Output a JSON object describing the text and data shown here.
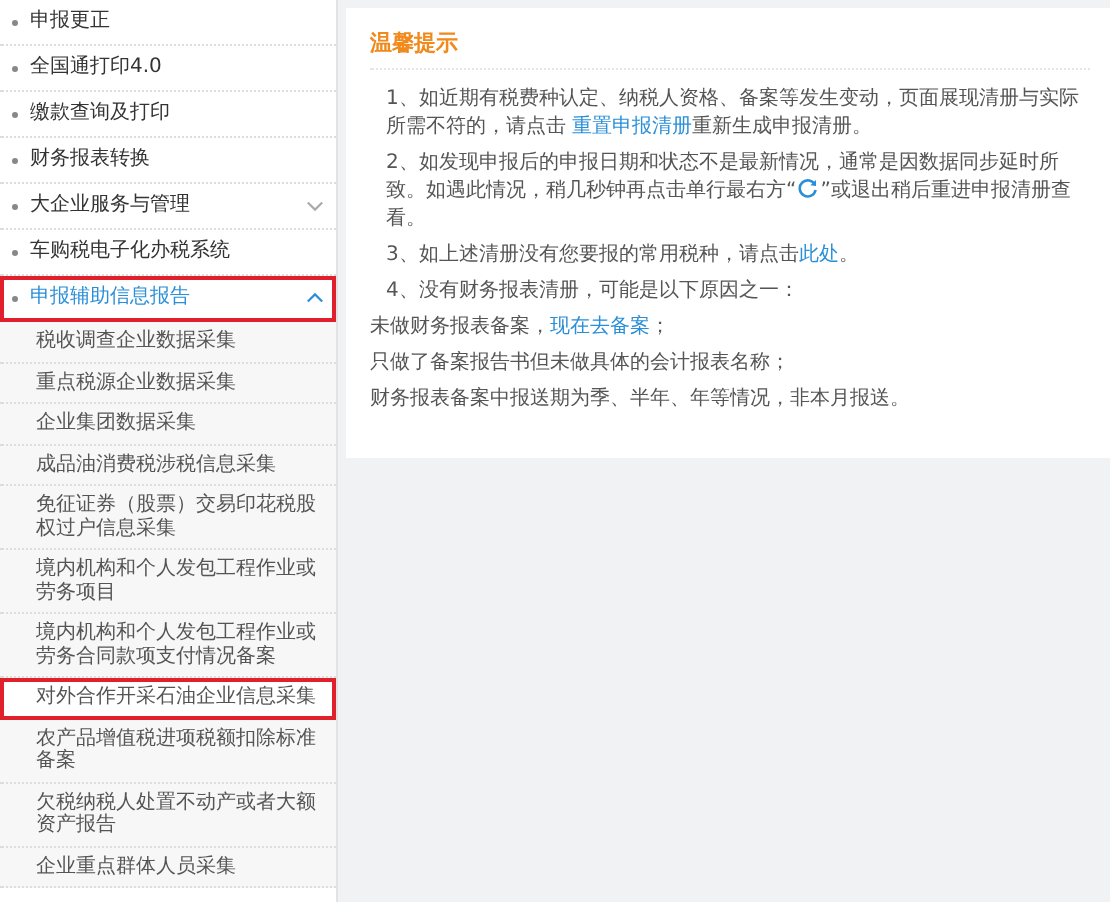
{
  "sidebar": {
    "items": [
      {
        "label": "申报更正",
        "selected": false,
        "marked": false
      },
      {
        "label": "全国通打印4.0",
        "selected": false,
        "marked": false
      },
      {
        "label": "缴款查询及打印",
        "selected": false,
        "marked": false
      },
      {
        "label": "财务报表转换",
        "selected": false,
        "marked": false
      },
      {
        "label": "大企业服务与管理",
        "selected": false,
        "marked": false,
        "expanded": false
      },
      {
        "label": "车购税电子化办税系统",
        "selected": false,
        "marked": false
      },
      {
        "label": "申报辅助信息报告",
        "selected": true,
        "marked": true,
        "expanded": true,
        "children": [
          {
            "label": "税收调查企业数据采集",
            "marked": false
          },
          {
            "label": "重点税源企业数据采集",
            "marked": false
          },
          {
            "label": "企业集团数据采集",
            "marked": false
          },
          {
            "label": "成品油消费税涉税信息采集",
            "marked": false
          },
          {
            "label": "免征证券（股票）交易印花税股权过户信息采集",
            "marked": false
          },
          {
            "label": "境内机构和个人发包工程作业或劳务项目",
            "marked": false
          },
          {
            "label": "境内机构和个人发包工程作业或劳务合同款项支付情况备案",
            "marked": false
          },
          {
            "label": "对外合作开采石油企业信息采集",
            "marked": true
          },
          {
            "label": "农产品增值税进项税额扣除标准备案",
            "marked": false
          },
          {
            "label": "欠税纳税人处置不动产或者大额资产报告",
            "marked": false
          },
          {
            "label": "企业重点群体人员采集",
            "marked": false
          }
        ]
      }
    ]
  },
  "notice": {
    "title": "温馨提示",
    "lines": [
      {
        "indent": true,
        "parts": [
          {
            "kind": "text",
            "text": "1、如近期有税费种认定、纳税人资格、备案等发生变动，页面展现清册与实际所需不符的，请点击 "
          },
          {
            "kind": "link",
            "text": "重置申报清册"
          },
          {
            "kind": "text",
            "text": "重新生成申报清册。"
          }
        ]
      },
      {
        "indent": true,
        "parts": [
          {
            "kind": "text",
            "text": "2、如发现申报后的申报日期和状态不是最新情况，通常是因数据同步延时所致。如遇此情况，稍几秒钟再点击单行最右方“"
          },
          {
            "kind": "icon"
          },
          {
            "kind": "text",
            "text": "”或退出稍后重进申报清册查看。"
          }
        ]
      },
      {
        "indent": true,
        "parts": [
          {
            "kind": "text",
            "text": "3、如上述清册没有您要报的常用税种，请点击"
          },
          {
            "kind": "link",
            "text": "此处"
          },
          {
            "kind": "text",
            "text": "。"
          }
        ]
      },
      {
        "indent": true,
        "parts": [
          {
            "kind": "text",
            "text": "4、没有财务报表清册，可能是以下原因之一："
          }
        ]
      },
      {
        "indent": false,
        "parts": [
          {
            "kind": "text",
            "text": "未做财务报表备案，"
          },
          {
            "kind": "link",
            "text": "现在去备案"
          },
          {
            "kind": "text",
            "text": "；"
          }
        ]
      },
      {
        "indent": false,
        "parts": [
          {
            "kind": "text",
            "text": "只做了备案报告书但未做具体的会计报表名称；"
          }
        ]
      },
      {
        "indent": false,
        "parts": [
          {
            "kind": "text",
            "text": "财务报表备案中报送期为季、半年、年等情况，非本月报送。"
          }
        ]
      }
    ]
  }
}
